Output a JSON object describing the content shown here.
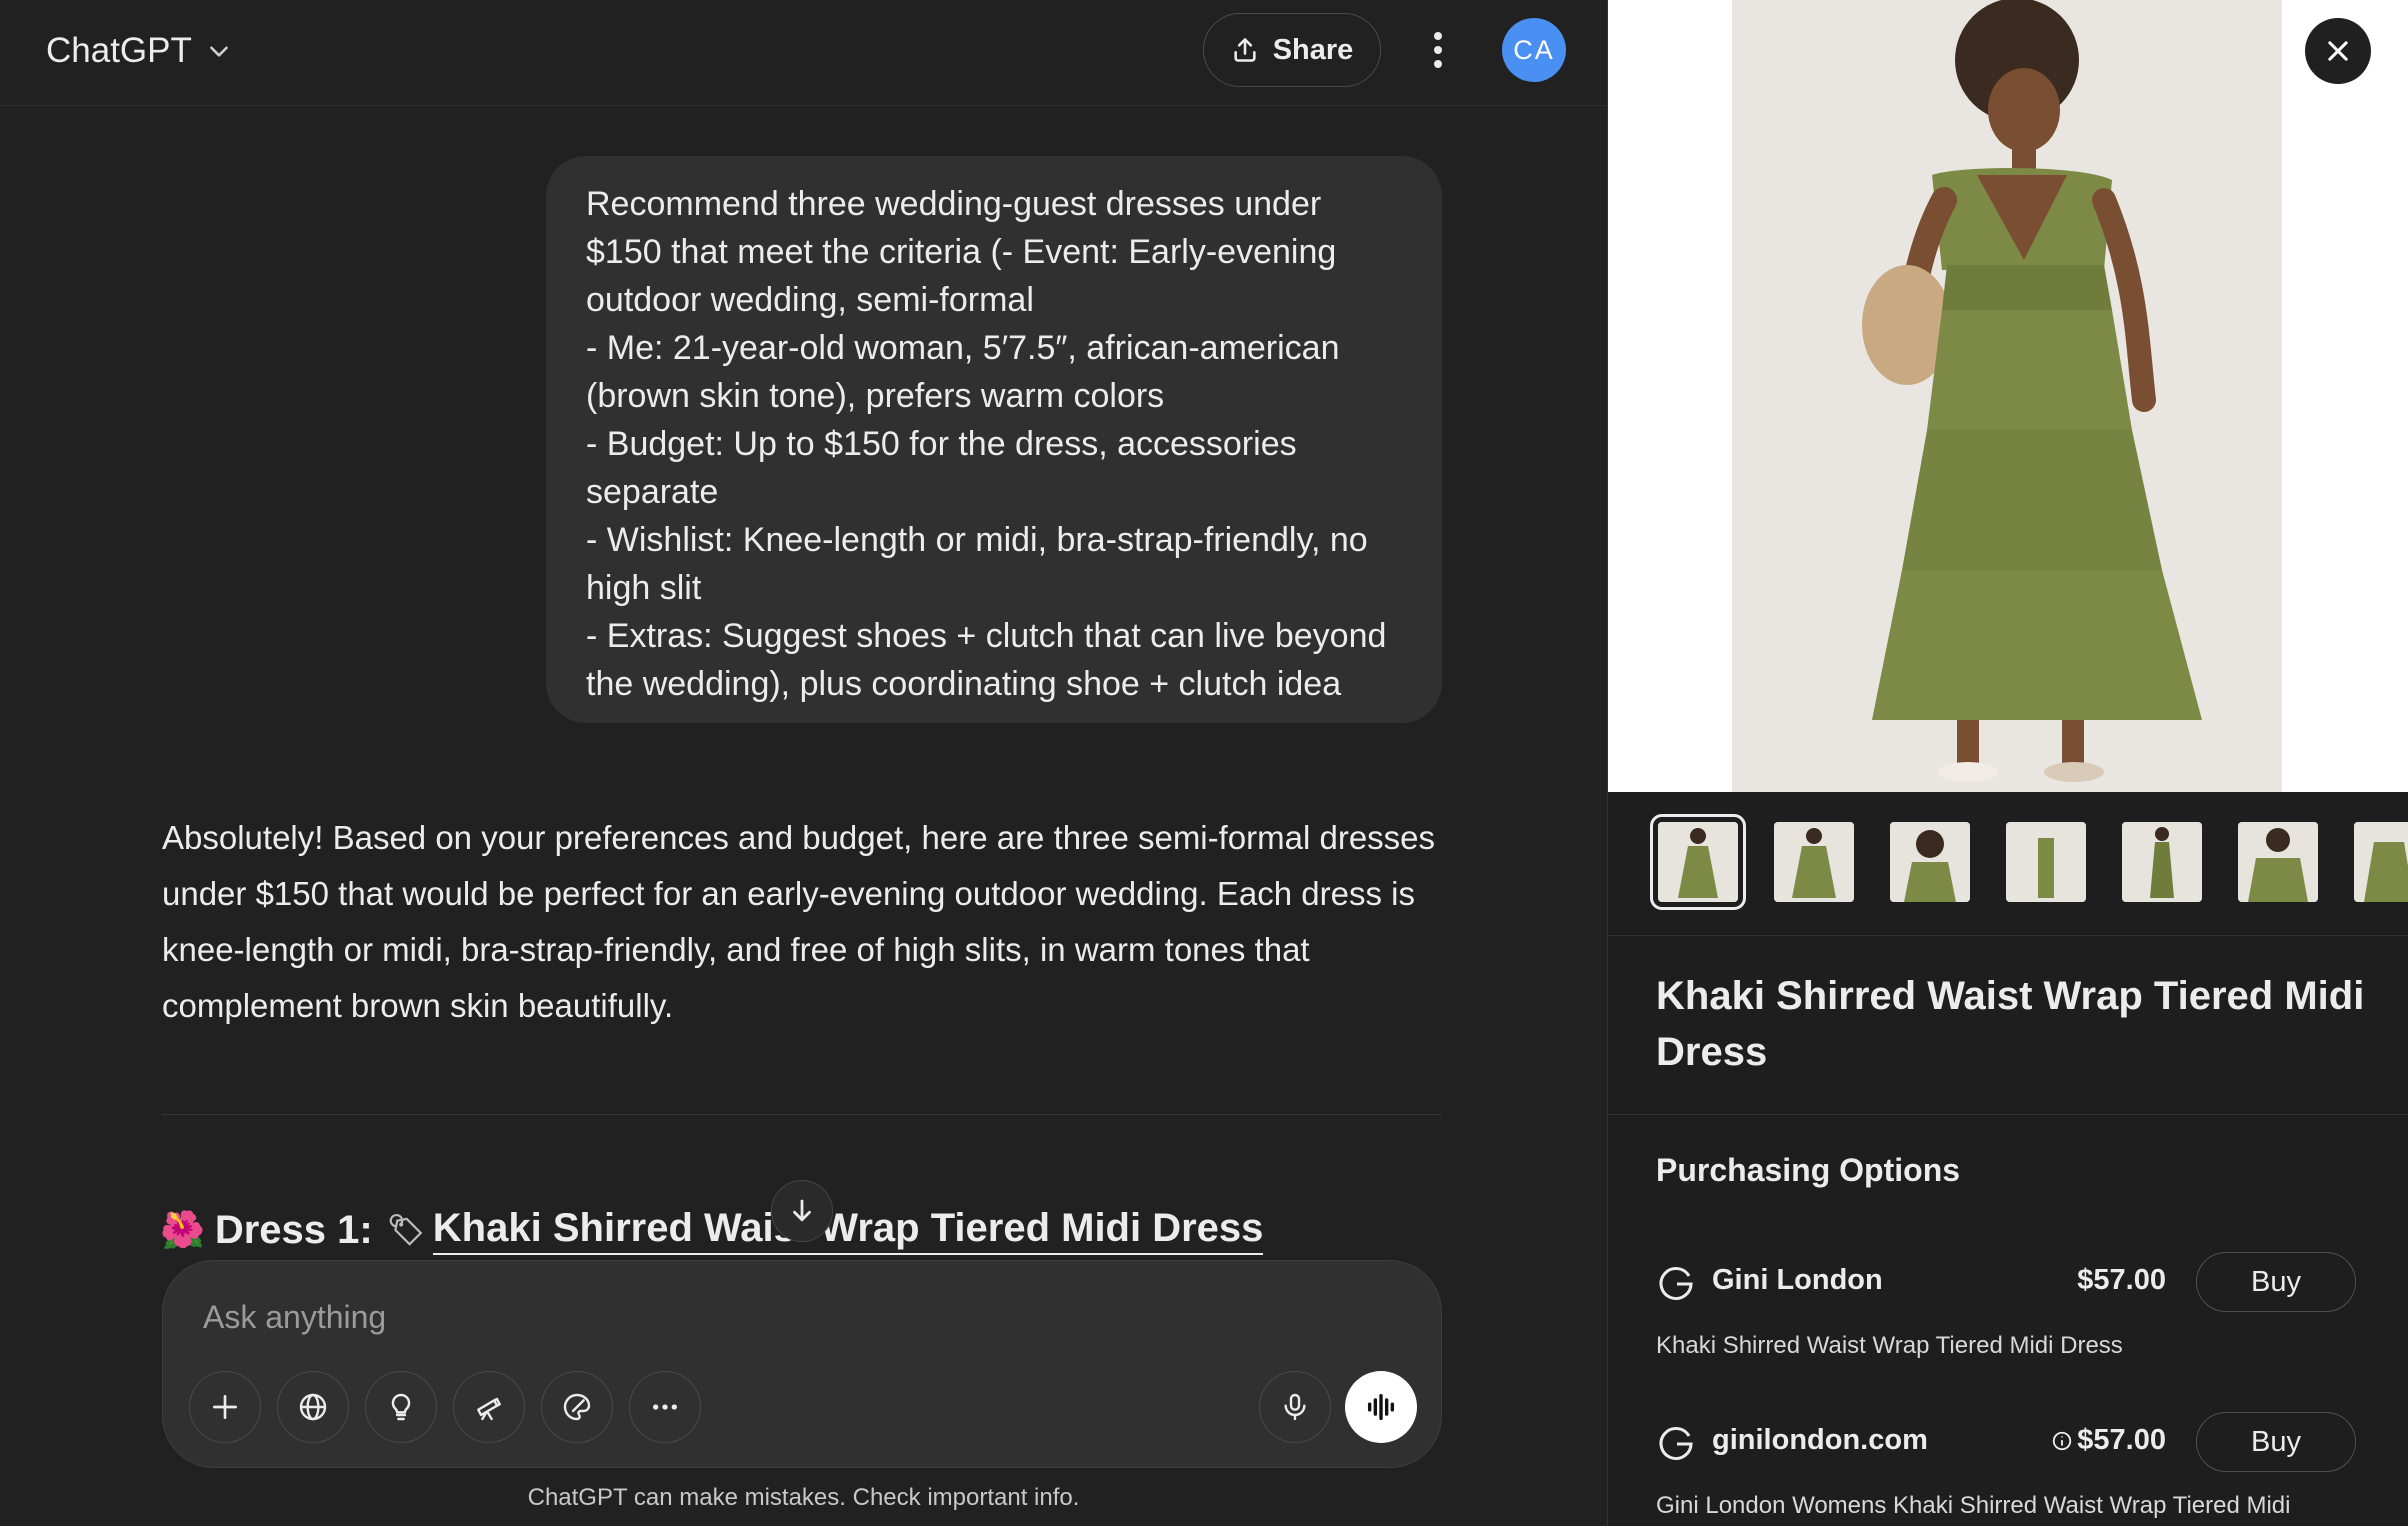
{
  "header": {
    "model_name": "ChatGPT",
    "share_label": "Share",
    "avatar_initials": "CA"
  },
  "conversation": {
    "user_message": "Recommend three wedding-guest dresses under $150 that meet the criteria (- Event: Early-evening outdoor wedding, semi-formal\n- Me: 21-year-old woman, 5′7.5″, african-american (brown skin tone), prefers warm colors\n- Budget: Up to $150 for the dress, accessories separate\n- Wishlist: Knee-length or midi, bra-strap-friendly, no high slit\n- Extras: Suggest shoes + clutch that can live beyond the wedding), plus coordinating shoe + clutch idea",
    "assistant_intro": "Absolutely! Based on your preferences and budget, here are three semi-formal dresses under $150 that would be perfect for an early-evening outdoor wedding. Each dress is knee-length or midi, bra-strap-friendly, and free of high slits, in warm tones that complement brown skin beautifully.",
    "dress_heading_emoji": "🌺",
    "dress_heading_prefix": "Dress 1:",
    "dress_heading_tag": "🏷",
    "dress_heading_link": "Khaki Shirred Waist Wrap Tiered Midi Dress"
  },
  "composer": {
    "placeholder": "Ask anything",
    "tools": [
      "plus-icon",
      "globe-icon",
      "lightbulb-icon",
      "telescope-icon",
      "paint-icon",
      "more-icon",
      "microphone-icon"
    ],
    "disclaimer": "ChatGPT can make mistakes. Check important info."
  },
  "product_panel": {
    "title": "Khaki Shirred Waist Wrap Tiered Midi Dress",
    "purchasing_title": "Purchasing Options",
    "offers": [
      {
        "seller": "Gini London",
        "price": "$57.00",
        "buy_label": "Buy",
        "description": "Khaki Shirred Waist Wrap Tiered Midi Dress"
      },
      {
        "seller": "ginilondon.com",
        "price": "$57.00",
        "buy_label": "Buy",
        "description": "Gini London Womens Khaki Shirred Waist Wrap Tiered Midi"
      }
    ],
    "thumbnail_count": 7
  },
  "colors": {
    "background": "#212121",
    "bubble": "#303030",
    "panel": "#1e1e1e",
    "avatar": "#4a90f2",
    "dress": "#7d8a45"
  }
}
